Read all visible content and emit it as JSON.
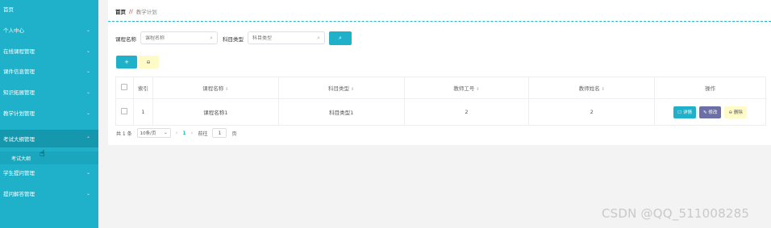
{
  "sidebar": {
    "items": [
      {
        "label": "首页",
        "chevron": ""
      },
      {
        "label": "个人中心",
        "chevron": "⌄"
      },
      {
        "label": "在线课程管理",
        "chevron": "⌄"
      },
      {
        "label": "课件信息管理",
        "chevron": "⌄"
      },
      {
        "label": "知识拓展管理",
        "chevron": "⌄"
      },
      {
        "label": "教学计划管理",
        "chevron": "⌄"
      },
      {
        "label": "考试大纲管理",
        "chevron": "⌃"
      },
      {
        "label": "学生提问管理",
        "chevron": "⌄"
      },
      {
        "label": "提问解答管理",
        "chevron": "⌄"
      }
    ],
    "sub_item": "考试大纲",
    "accent": "#1fb1c9"
  },
  "breadcrumb": {
    "home": "首页",
    "separator": "//",
    "current": "教学计划"
  },
  "filters": {
    "course_label": "课程名称",
    "course_placeholder": "课程名称",
    "subject_label": "科目类型",
    "subject_placeholder": "科目类型",
    "search_icon": "search-icon"
  },
  "toolbar": {
    "add_label": "+",
    "delete_label": "⊖"
  },
  "table": {
    "headers": [
      "",
      "索引",
      "课程名称",
      "科目类型",
      "教师工号",
      "教师姓名",
      "操作"
    ],
    "sort_icon": "⇕",
    "rows": [
      {
        "index": "1",
        "course": "课程名称1",
        "subject": "科目类型1",
        "teacher_id": "2",
        "teacher_name": "2"
      }
    ],
    "actions": {
      "detail": "☐ 详情",
      "edit": "✎ 修改",
      "delete": "⊖ 删除"
    }
  },
  "pagination": {
    "total": "共 1 条",
    "page_size": "10条/页",
    "prev": "‹",
    "current_page": "1",
    "next": "›",
    "goto_label": "前往",
    "goto_value": "1",
    "page_unit": "页"
  },
  "watermark": "CSDN @QQ_511008285"
}
